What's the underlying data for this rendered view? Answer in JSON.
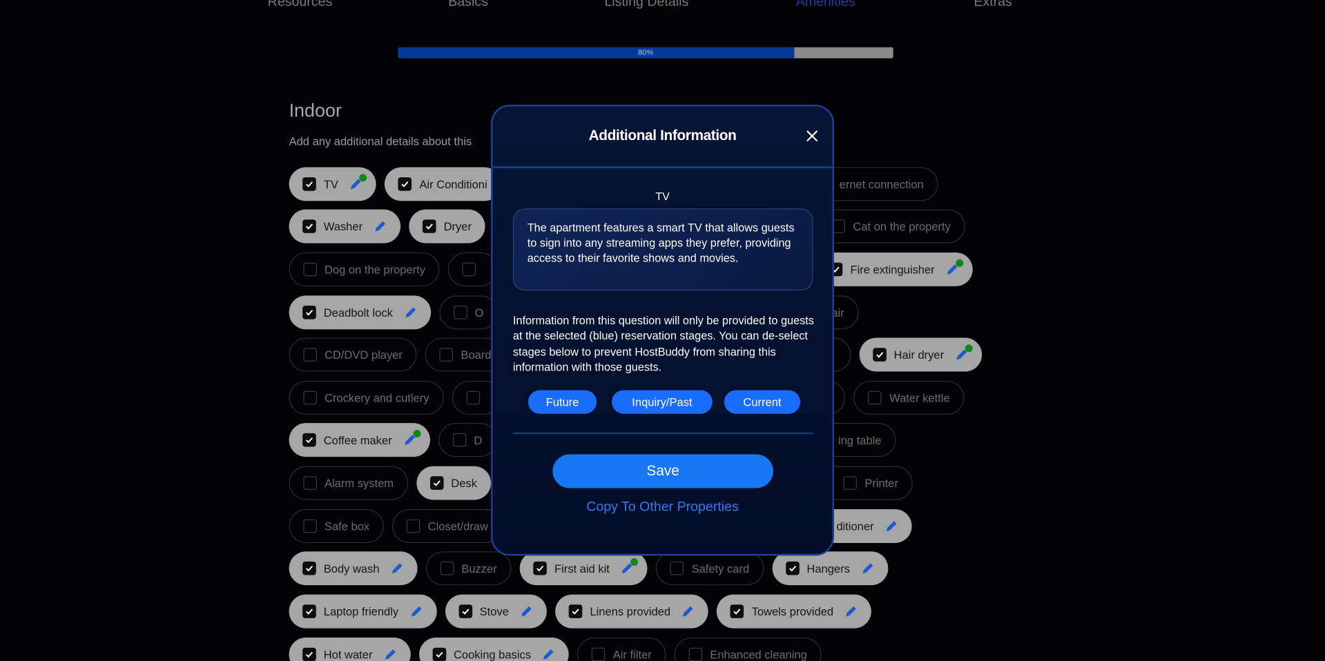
{
  "steps": {
    "tabs": [
      {
        "label": "Resources",
        "active": false
      },
      {
        "label": "Basics",
        "active": false
      },
      {
        "label": "Listing Details",
        "active": false
      },
      {
        "label": "Amenities",
        "active": true
      },
      {
        "label": "Extras",
        "active": false
      }
    ],
    "progress_percent": 80,
    "progress_label": "80%"
  },
  "section": {
    "title": "Indoor",
    "subtitle": "Add any additional details about this"
  },
  "rows": [
    {
      "left": [
        {
          "label": "TV",
          "checked": true,
          "edit": true,
          "note": true
        },
        {
          "label": "Air Conditioni",
          "checked": true
        }
      ],
      "right": [
        {
          "label": "ernet connection",
          "checked": false,
          "cut": true,
          "nobox": true
        }
      ]
    },
    {
      "left": [
        {
          "label": "Washer",
          "checked": true,
          "edit": true
        },
        {
          "label": "Dryer",
          "checked": true
        }
      ],
      "right": [
        {
          "label": "Cat on the property",
          "checked": false,
          "cut": true
        }
      ]
    },
    {
      "left": [
        {
          "label": "Dog on the property",
          "checked": false
        },
        {
          "label": "",
          "checked": false
        }
      ],
      "right": [
        {
          "label": "Fire extinguisher",
          "checked": true,
          "edit": true,
          "note": true,
          "cut": true
        }
      ]
    },
    {
      "left": [
        {
          "label": "Deadbolt lock",
          "checked": true,
          "edit": true
        },
        {
          "label": "O",
          "checked": false
        }
      ],
      "right": [
        {
          "label": "air",
          "checked": false,
          "cut": true,
          "nobox": true
        }
      ]
    },
    {
      "left": [
        {
          "label": "CD/DVD player",
          "checked": false
        },
        {
          "label": "Board",
          "checked": false
        }
      ],
      "right": [
        {
          "label": "",
          "checked": false,
          "cut": true,
          "nobox": true
        },
        {
          "label": "Hair dryer",
          "checked": true,
          "edit": true,
          "note": true
        }
      ]
    },
    {
      "left": [
        {
          "label": "Crockery and cutlery",
          "checked": false
        },
        {
          "label": "",
          "checked": false
        }
      ],
      "right": [
        {
          "label": "",
          "checked": false,
          "cut": true,
          "nobox": true
        },
        {
          "label": "Water kettle",
          "checked": false
        }
      ]
    },
    {
      "left": [
        {
          "label": "Coffee maker",
          "checked": true,
          "edit": true,
          "note": true
        },
        {
          "label": "D",
          "checked": false
        }
      ],
      "right": [
        {
          "label": "ing table",
          "checked": false,
          "cut": true,
          "nobox": true
        }
      ]
    },
    {
      "left": [
        {
          "label": "Alarm system",
          "checked": false
        },
        {
          "label": "Desk",
          "checked": true
        }
      ],
      "right": [
        {
          "label": "Printer",
          "checked": false,
          "cut": true
        }
      ]
    },
    {
      "left": [
        {
          "label": "Safe box",
          "checked": false
        },
        {
          "label": "Closet/draw",
          "checked": false
        }
      ],
      "right": [
        {
          "label": "ditioner",
          "checked": true,
          "edit": true,
          "cut": true,
          "nobox": true
        }
      ]
    },
    {
      "left": [
        {
          "label": "Body wash",
          "checked": true,
          "edit": true
        },
        {
          "label": "Buzzer",
          "checked": false
        },
        {
          "label": "First aid kit",
          "checked": true,
          "edit": true,
          "note": true
        },
        {
          "label": "Safety card",
          "checked": false
        },
        {
          "label": "Hangers",
          "checked": true,
          "edit": true
        }
      ],
      "right": []
    },
    {
      "left": [
        {
          "label": "Laptop friendly",
          "checked": true,
          "edit": true
        },
        {
          "label": "Stove",
          "checked": true,
          "edit": true
        },
        {
          "label": "Linens provided",
          "checked": true,
          "edit": true
        },
        {
          "label": "Towels provided",
          "checked": true,
          "edit": true
        }
      ],
      "right": []
    },
    {
      "left": [
        {
          "label": "Hot water",
          "checked": true,
          "edit": true
        },
        {
          "label": "Cooking basics",
          "checked": true,
          "edit": true
        },
        {
          "label": "Air filter",
          "checked": false
        },
        {
          "label": "Enhanced cleaning",
          "checked": false
        }
      ],
      "right": []
    }
  ],
  "modal": {
    "title": "Additional Information",
    "field_label": "TV",
    "description": "The apartment features a smart TV that allows guests to sign into any streaming apps they prefer, providing access to their favorite shows and movies.",
    "info": "Information from this question will only be provided to guests at the selected (blue) reservation stages. You can de-select stages below to prevent HostBuddy from sharing this information with those guests.",
    "stages": [
      {
        "label": "Future",
        "selected": true
      },
      {
        "label": "Inquiry/Past",
        "selected": true
      },
      {
        "label": "Current",
        "selected": true
      }
    ],
    "save_label": "Save",
    "copy_label": "Copy To Other Properties"
  },
  "colors": {
    "accent": "#1a6dfb",
    "active_tab": "#1b3f9e",
    "progress_fill": "#073a98",
    "note_dot": "#0c8a1c",
    "edit_icon": "#1d5ad0"
  }
}
